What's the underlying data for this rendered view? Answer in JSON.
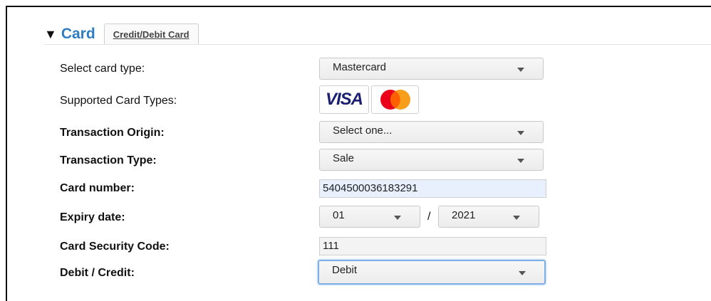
{
  "section": {
    "title": "Card",
    "tab_label": "Credit/Debit Card"
  },
  "fields": {
    "card_type": {
      "label": "Select card type:",
      "value": "Mastercard"
    },
    "supported_types": {
      "label": "Supported Card Types:",
      "visa_text": "VISA",
      "cards": [
        "visa-icon",
        "mastercard-icon"
      ]
    },
    "transaction_origin": {
      "label": "Transaction Origin:",
      "value": "Select one..."
    },
    "transaction_type": {
      "label": "Transaction Type:",
      "value": "Sale"
    },
    "card_number": {
      "label": "Card number:",
      "value": "5404500036183291"
    },
    "expiry": {
      "label": "Expiry date:",
      "month": "01",
      "separator": "/",
      "year": "2021"
    },
    "security_code": {
      "label": "Card Security Code:",
      "value": "111"
    },
    "debit_credit": {
      "label": "Debit / Credit:",
      "value": "Debit"
    }
  },
  "colors": {
    "title": "#2f7dc1",
    "mastercard_red": "#eb001b",
    "mastercard_orange": "#f79e1b",
    "visa_blue": "#1a1f71",
    "autofill": "#e8f0fe",
    "focus": "#7eaee6"
  }
}
